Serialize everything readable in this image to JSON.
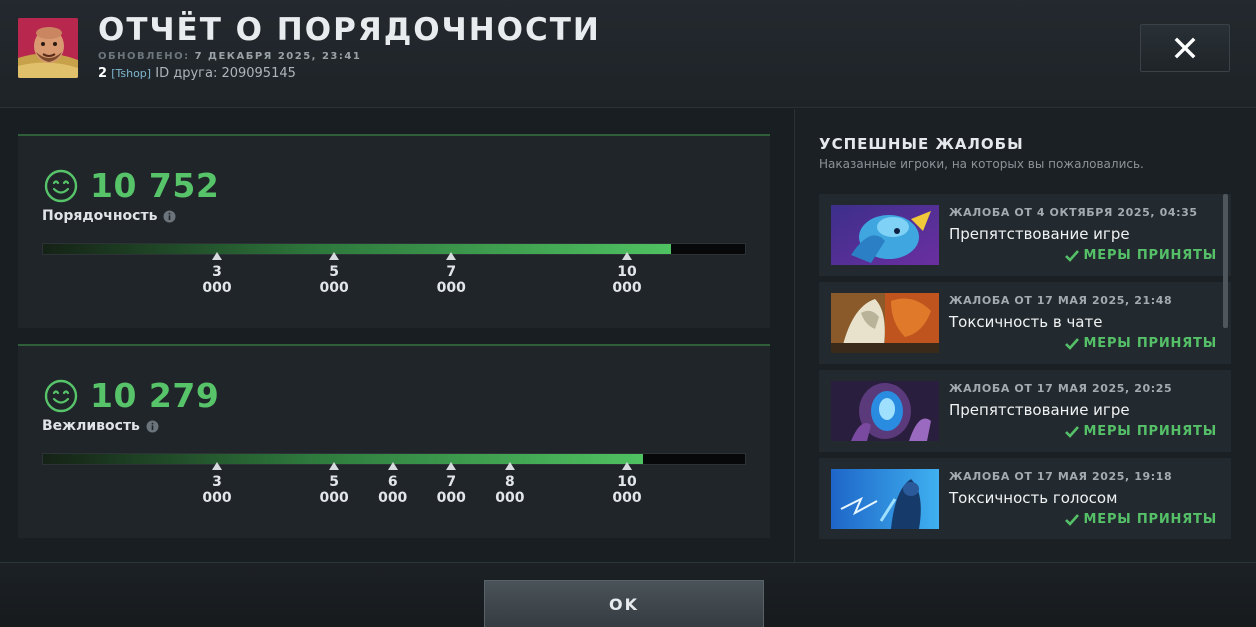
{
  "header": {
    "title": "ОТЧЁТ О ПОРЯДОЧНОСТИ",
    "updated_label": "ОБНОВЛЕНО:",
    "updated_value": "7 ДЕКАБРЯ 2025, 23:41",
    "friend_count": "2",
    "friend_tag": "[Tshop]",
    "friend_id": "ID друга: 209095145",
    "close_icon": "close-icon"
  },
  "conduct": {
    "score": "10 752",
    "label": "Порядочность",
    "fill_fraction": 0.895,
    "ticks": [
      {
        "label": "3 000",
        "value": 3000
      },
      {
        "label": "5 000",
        "value": 5000
      },
      {
        "label": "7 000",
        "value": 7000
      },
      {
        "label": "10 000",
        "value": 10000
      }
    ]
  },
  "behavior": {
    "score": "10 279",
    "label": "Вежливость",
    "fill_fraction": 0.855,
    "ticks": [
      {
        "label": "3 000",
        "value": 3000
      },
      {
        "label": "5 000",
        "value": 5000
      },
      {
        "label": "6 000",
        "value": 6000
      },
      {
        "label": "7 000",
        "value": 7000
      },
      {
        "label": "8 000",
        "value": 8000
      },
      {
        "label": "10 000",
        "value": 10000
      }
    ]
  },
  "reports_panel": {
    "title": "УСПЕШНЫЕ ЖАЛОБЫ",
    "subtitle": "Наказанные игроки, на которых вы пожаловались.",
    "items": [
      {
        "date": "ЖАЛОБА ОТ 4 ОКТЯБРЯ 2025, 04:35",
        "reason": "Препятствование игре",
        "status": "МЕРЫ ПРИНЯТЫ"
      },
      {
        "date": "ЖАЛОБА ОТ 17 МАЯ 2025, 21:48",
        "reason": "Токсичность в чате",
        "status": "МЕРЫ ПРИНЯТЫ"
      },
      {
        "date": "ЖАЛОБА ОТ 17 МАЯ 2025, 20:25",
        "reason": "Препятствование игре",
        "status": "МЕРЫ ПРИНЯТЫ"
      },
      {
        "date": "ЖАЛОБА ОТ 17 МАЯ 2025, 19:18",
        "reason": "Токсичность голосом",
        "status": "МЕРЫ ПРИНЯТЫ"
      }
    ]
  },
  "footer": {
    "ok_label": "OK"
  },
  "colors": {
    "accent_green": "#57c46a",
    "background": "#191e22"
  }
}
